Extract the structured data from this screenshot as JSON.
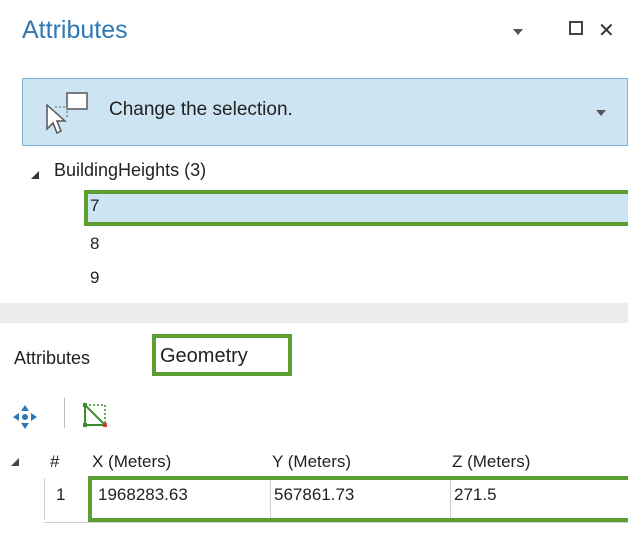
{
  "pane": {
    "title": "Attributes"
  },
  "selection": {
    "text": "Change the selection."
  },
  "tree": {
    "layer_label": "BuildingHeights (3)",
    "rows": [
      "7",
      "8",
      "9"
    ]
  },
  "tabs": [
    {
      "label": "Attributes",
      "selected": false
    },
    {
      "label": "Geometry",
      "selected": true
    }
  ],
  "table": {
    "headers": [
      "#",
      "X (Meters)",
      "Y (Meters)",
      "Z (Meters)"
    ],
    "rows": [
      {
        "index": "1",
        "x": "1968283.63",
        "y": "567861.73",
        "z": "271.5"
      }
    ]
  },
  "icons": {
    "pane_menu": "chevron-down-icon",
    "pane_maximize": "maximize-icon",
    "pane_close": "close-icon",
    "selection": "select-cursor-icon",
    "tree_expand": "tree-collapse-triangle-icon",
    "move": "move-arrows-icon",
    "vertex_edit": "vertex-edit-icon"
  },
  "colors": {
    "title_blue": "#2f78b4",
    "selection_bg": "#cde4f3",
    "highlight_green": "#5c9e2f"
  }
}
